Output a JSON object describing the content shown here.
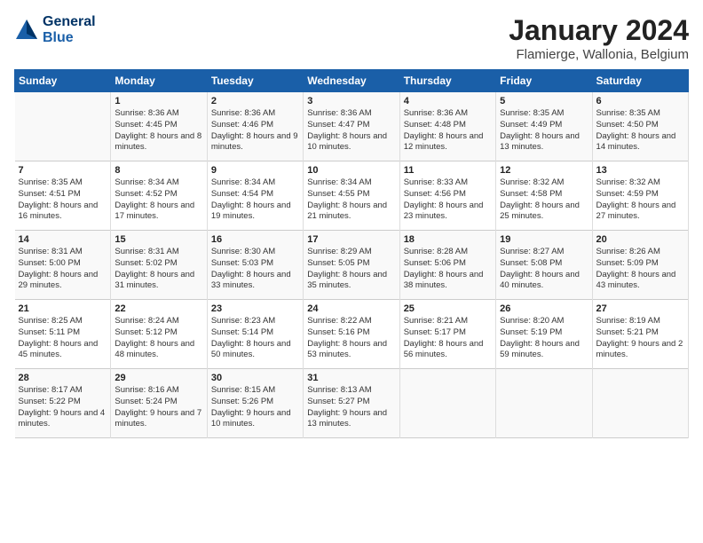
{
  "header": {
    "logo_line1": "General",
    "logo_line2": "Blue",
    "title": "January 2024",
    "subtitle": "Flamierge, Wallonia, Belgium"
  },
  "calendar": {
    "weekdays": [
      "Sunday",
      "Monday",
      "Tuesday",
      "Wednesday",
      "Thursday",
      "Friday",
      "Saturday"
    ],
    "rows": [
      [
        {
          "day": "",
          "sunrise": "",
          "sunset": "",
          "daylight": ""
        },
        {
          "day": "1",
          "sunrise": "Sunrise: 8:36 AM",
          "sunset": "Sunset: 4:45 PM",
          "daylight": "Daylight: 8 hours and 8 minutes."
        },
        {
          "day": "2",
          "sunrise": "Sunrise: 8:36 AM",
          "sunset": "Sunset: 4:46 PM",
          "daylight": "Daylight: 8 hours and 9 minutes."
        },
        {
          "day": "3",
          "sunrise": "Sunrise: 8:36 AM",
          "sunset": "Sunset: 4:47 PM",
          "daylight": "Daylight: 8 hours and 10 minutes."
        },
        {
          "day": "4",
          "sunrise": "Sunrise: 8:36 AM",
          "sunset": "Sunset: 4:48 PM",
          "daylight": "Daylight: 8 hours and 12 minutes."
        },
        {
          "day": "5",
          "sunrise": "Sunrise: 8:35 AM",
          "sunset": "Sunset: 4:49 PM",
          "daylight": "Daylight: 8 hours and 13 minutes."
        },
        {
          "day": "6",
          "sunrise": "Sunrise: 8:35 AM",
          "sunset": "Sunset: 4:50 PM",
          "daylight": "Daylight: 8 hours and 14 minutes."
        }
      ],
      [
        {
          "day": "7",
          "sunrise": "Sunrise: 8:35 AM",
          "sunset": "Sunset: 4:51 PM",
          "daylight": "Daylight: 8 hours and 16 minutes."
        },
        {
          "day": "8",
          "sunrise": "Sunrise: 8:34 AM",
          "sunset": "Sunset: 4:52 PM",
          "daylight": "Daylight: 8 hours and 17 minutes."
        },
        {
          "day": "9",
          "sunrise": "Sunrise: 8:34 AM",
          "sunset": "Sunset: 4:54 PM",
          "daylight": "Daylight: 8 hours and 19 minutes."
        },
        {
          "day": "10",
          "sunrise": "Sunrise: 8:34 AM",
          "sunset": "Sunset: 4:55 PM",
          "daylight": "Daylight: 8 hours and 21 minutes."
        },
        {
          "day": "11",
          "sunrise": "Sunrise: 8:33 AM",
          "sunset": "Sunset: 4:56 PM",
          "daylight": "Daylight: 8 hours and 23 minutes."
        },
        {
          "day": "12",
          "sunrise": "Sunrise: 8:32 AM",
          "sunset": "Sunset: 4:58 PM",
          "daylight": "Daylight: 8 hours and 25 minutes."
        },
        {
          "day": "13",
          "sunrise": "Sunrise: 8:32 AM",
          "sunset": "Sunset: 4:59 PM",
          "daylight": "Daylight: 8 hours and 27 minutes."
        }
      ],
      [
        {
          "day": "14",
          "sunrise": "Sunrise: 8:31 AM",
          "sunset": "Sunset: 5:00 PM",
          "daylight": "Daylight: 8 hours and 29 minutes."
        },
        {
          "day": "15",
          "sunrise": "Sunrise: 8:31 AM",
          "sunset": "Sunset: 5:02 PM",
          "daylight": "Daylight: 8 hours and 31 minutes."
        },
        {
          "day": "16",
          "sunrise": "Sunrise: 8:30 AM",
          "sunset": "Sunset: 5:03 PM",
          "daylight": "Daylight: 8 hours and 33 minutes."
        },
        {
          "day": "17",
          "sunrise": "Sunrise: 8:29 AM",
          "sunset": "Sunset: 5:05 PM",
          "daylight": "Daylight: 8 hours and 35 minutes."
        },
        {
          "day": "18",
          "sunrise": "Sunrise: 8:28 AM",
          "sunset": "Sunset: 5:06 PM",
          "daylight": "Daylight: 8 hours and 38 minutes."
        },
        {
          "day": "19",
          "sunrise": "Sunrise: 8:27 AM",
          "sunset": "Sunset: 5:08 PM",
          "daylight": "Daylight: 8 hours and 40 minutes."
        },
        {
          "day": "20",
          "sunrise": "Sunrise: 8:26 AM",
          "sunset": "Sunset: 5:09 PM",
          "daylight": "Daylight: 8 hours and 43 minutes."
        }
      ],
      [
        {
          "day": "21",
          "sunrise": "Sunrise: 8:25 AM",
          "sunset": "Sunset: 5:11 PM",
          "daylight": "Daylight: 8 hours and 45 minutes."
        },
        {
          "day": "22",
          "sunrise": "Sunrise: 8:24 AM",
          "sunset": "Sunset: 5:12 PM",
          "daylight": "Daylight: 8 hours and 48 minutes."
        },
        {
          "day": "23",
          "sunrise": "Sunrise: 8:23 AM",
          "sunset": "Sunset: 5:14 PM",
          "daylight": "Daylight: 8 hours and 50 minutes."
        },
        {
          "day": "24",
          "sunrise": "Sunrise: 8:22 AM",
          "sunset": "Sunset: 5:16 PM",
          "daylight": "Daylight: 8 hours and 53 minutes."
        },
        {
          "day": "25",
          "sunrise": "Sunrise: 8:21 AM",
          "sunset": "Sunset: 5:17 PM",
          "daylight": "Daylight: 8 hours and 56 minutes."
        },
        {
          "day": "26",
          "sunrise": "Sunrise: 8:20 AM",
          "sunset": "Sunset: 5:19 PM",
          "daylight": "Daylight: 8 hours and 59 minutes."
        },
        {
          "day": "27",
          "sunrise": "Sunrise: 8:19 AM",
          "sunset": "Sunset: 5:21 PM",
          "daylight": "Daylight: 9 hours and 2 minutes."
        }
      ],
      [
        {
          "day": "28",
          "sunrise": "Sunrise: 8:17 AM",
          "sunset": "Sunset: 5:22 PM",
          "daylight": "Daylight: 9 hours and 4 minutes."
        },
        {
          "day": "29",
          "sunrise": "Sunrise: 8:16 AM",
          "sunset": "Sunset: 5:24 PM",
          "daylight": "Daylight: 9 hours and 7 minutes."
        },
        {
          "day": "30",
          "sunrise": "Sunrise: 8:15 AM",
          "sunset": "Sunset: 5:26 PM",
          "daylight": "Daylight: 9 hours and 10 minutes."
        },
        {
          "day": "31",
          "sunrise": "Sunrise: 8:13 AM",
          "sunset": "Sunset: 5:27 PM",
          "daylight": "Daylight: 9 hours and 13 minutes."
        },
        {
          "day": "",
          "sunrise": "",
          "sunset": "",
          "daylight": ""
        },
        {
          "day": "",
          "sunrise": "",
          "sunset": "",
          "daylight": ""
        },
        {
          "day": "",
          "sunrise": "",
          "sunset": "",
          "daylight": ""
        }
      ]
    ]
  }
}
